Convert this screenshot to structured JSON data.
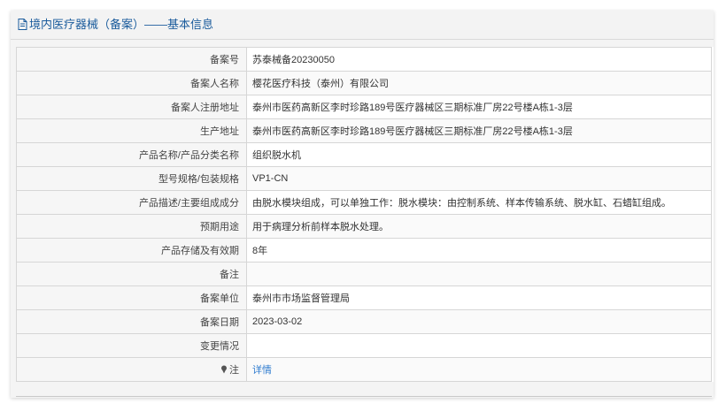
{
  "header": {
    "title_icon": "document-icon",
    "title": "境内医疗器械（备案）——基本信息"
  },
  "rows": [
    {
      "label": "备案号",
      "value": "苏泰械备20230050"
    },
    {
      "label": "备案人名称",
      "value": "樱花医疗科技（泰州）有限公司"
    },
    {
      "label": "备案人注册地址",
      "value": "泰州市医药高新区李时珍路189号医疗器械区三期标准厂房22号楼A栋1-3层"
    },
    {
      "label": "生产地址",
      "value": "泰州市医药高新区李时珍路189号医疗器械区三期标准厂房22号楼A栋1-3层"
    },
    {
      "label": "产品名称/产品分类名称",
      "value": "组织脱水机"
    },
    {
      "label": "型号规格/包装规格",
      "value": "VP1-CN"
    },
    {
      "label": "产品描述/主要组成成分",
      "value": "由脱水模块组成，可以单独工作：脱水模块：由控制系统、样本传输系统、脱水缸、石蜡缸组成。"
    },
    {
      "label": "预期用途",
      "value": "用于病理分析前样本脱水处理。"
    },
    {
      "label": "产品存储及有效期",
      "value": "8年"
    },
    {
      "label": "备注",
      "value": ""
    },
    {
      "label": "备案单位",
      "value": "泰州市市场监督管理局"
    },
    {
      "label": "备案日期",
      "value": "2023-03-02"
    },
    {
      "label": "变更情况",
      "value": ""
    }
  ],
  "note_row": {
    "icon": "pin-icon",
    "label": "注",
    "link_text": "详情",
    "link_color": "#2e7bcf"
  },
  "colors": {
    "header_text": "#1a5b9c",
    "label_bg": "#f6f6f6",
    "border": "#d6d6d6"
  }
}
